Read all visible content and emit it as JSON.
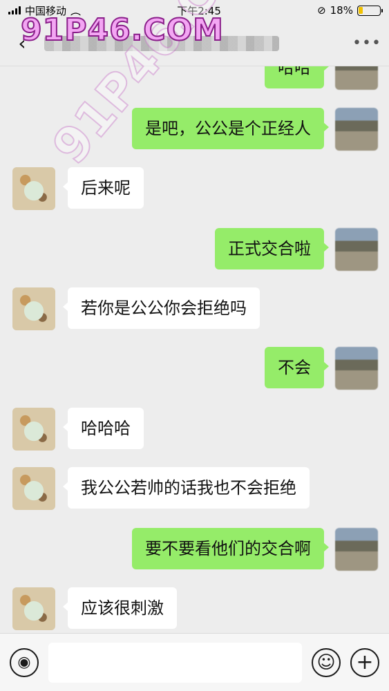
{
  "status_bar": {
    "carrier": "中国移动",
    "time": "下午2:45",
    "battery_percent": "18%",
    "battery_level": 0.18,
    "wifi_icon": "wifi-icon",
    "rotation_lock_icon": "rotation-lock-icon"
  },
  "watermark": {
    "text": "91P46.COM"
  },
  "nav": {
    "back_icon": "back-chevron-icon",
    "more_icon": "more-icon"
  },
  "messages": [
    {
      "side": "out",
      "text": "哈哈"
    },
    {
      "side": "out",
      "text": "是吧，公公是个正经人"
    },
    {
      "side": "in",
      "text": "后来呢"
    },
    {
      "side": "out",
      "text": "正式交合啦"
    },
    {
      "side": "in",
      "text": "若你是公公你会拒绝吗"
    },
    {
      "side": "out",
      "text": "不会"
    },
    {
      "side": "in",
      "text": "哈哈哈"
    },
    {
      "side": "in",
      "text": "我公公若帅的话我也不会拒绝"
    },
    {
      "side": "out",
      "text": "要不要看他们的交合啊"
    },
    {
      "side": "in",
      "text": "应该很刺激"
    }
  ],
  "input_bar": {
    "voice_icon": "voice-icon",
    "emoji_icon": "emoji-icon",
    "plus_icon": "plus-icon",
    "value": ""
  }
}
